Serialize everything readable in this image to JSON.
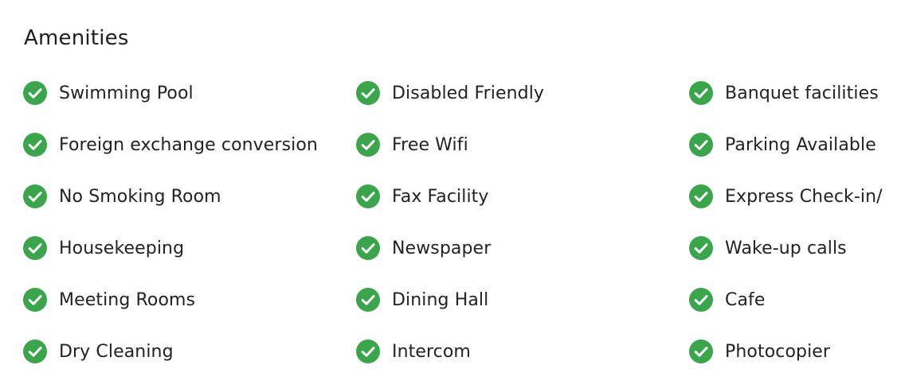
{
  "section": {
    "title": "Amenities"
  },
  "theme": {
    "check_color": "#3aa54b",
    "check_mark_color": "#ffffff",
    "text_color": "#222222"
  },
  "icon": "check-circle-icon",
  "amenities": [
    {
      "label": "Swimming Pool"
    },
    {
      "label": "Disabled Friendly"
    },
    {
      "label": "Banquet facilities"
    },
    {
      "label": "Foreign exchange conversion"
    },
    {
      "label": "Free Wifi"
    },
    {
      "label": "Parking Available"
    },
    {
      "label": "No Smoking Room"
    },
    {
      "label": "Fax Facility"
    },
    {
      "label": "Express Check-in/"
    },
    {
      "label": "Housekeeping"
    },
    {
      "label": "Newspaper"
    },
    {
      "label": "Wake-up calls"
    },
    {
      "label": "Meeting Rooms"
    },
    {
      "label": "Dining Hall"
    },
    {
      "label": "Cafe"
    },
    {
      "label": "Dry Cleaning"
    },
    {
      "label": "Intercom"
    },
    {
      "label": "Photocopier"
    }
  ]
}
